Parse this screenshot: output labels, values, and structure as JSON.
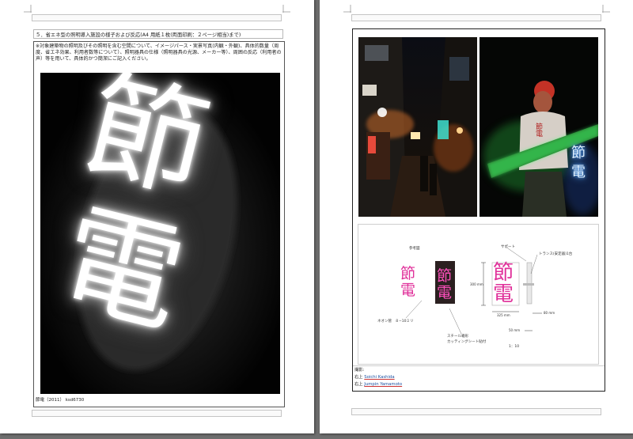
{
  "left_page": {
    "section_title": "５．省エネ型の照明導入施設の様子および反応(A4 用紙１枚(両面印刷：２ページ相当)まで)",
    "instruction": "※対象建築物の照明及びその照明を含む空間について、イメージパース・実景写真(内観・外観)、具体的数量（周度、省エネ効果、利用者数等について）、照明器具の仕様（照明器具の光源、メーカー等）、周囲の反応（利用者の声）等を用いて、具体的かつ簡潔にご記入ください。",
    "neon_text_top": "節",
    "neon_text_bottom": "電",
    "caption": "節電（2011） ksd6730"
  },
  "right_page": {
    "photo_bar_signs": [
      "節",
      "電"
    ],
    "photo_person_shirt": "節電",
    "photo_person_sign": [
      "節",
      "電"
    ],
    "diagram": {
      "label_reference": "参考図",
      "pink_chars": [
        "節",
        "電"
      ],
      "dark_chars": [
        "節",
        "電"
      ],
      "main_chars": [
        "節",
        "電"
      ],
      "label_support": "サポート",
      "label_transformer": "トランス(安定器)1台",
      "label_height": "300 mm",
      "label_width": "325 mm",
      "label_depth": "80 mm",
      "label_base": "50 mm",
      "label_neon": "ネオン管　８−10ミリ",
      "label_frame_line1": "スチール箱形",
      "label_frame_line2": "カッティングシート貼付",
      "label_scale": "1：10"
    },
    "credits": {
      "heading": "撮影:",
      "line1_prefix": "右上",
      "line1_name": "Soichi Kashida",
      "line2_prefix": "右上",
      "line2_name": "Jumpin Yamamoto"
    }
  },
  "colors": {
    "neon_pink": "#e0309a",
    "neon_green": "#3cff6a",
    "neon_blue": "#58a8ff",
    "workspace_bg": "#6f6f6f"
  }
}
